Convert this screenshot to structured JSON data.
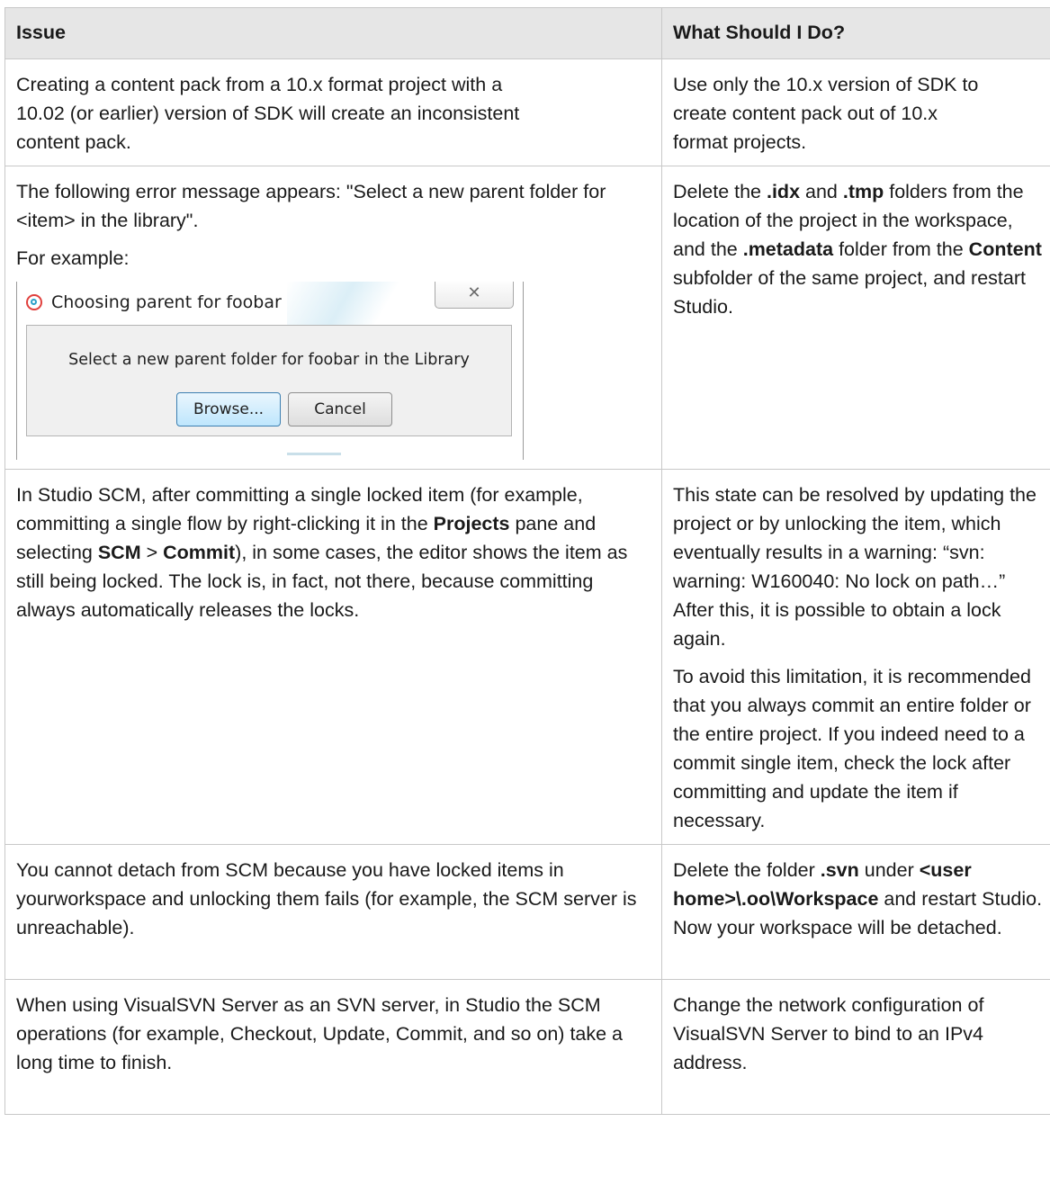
{
  "table": {
    "headers": {
      "issue": "Issue",
      "action": "What Should I Do?"
    },
    "rows": [
      {
        "issue": {
          "line1": "Creating a content pack from a 10.x format project with a",
          "line2": "10.02 (or earlier) version of SDK will create an inconsistent",
          "line3": "content pack."
        },
        "action": {
          "line1": "Use only the 10.x version of SDK to",
          "line2": "create content pack out of 10.x",
          "line3": "format projects."
        }
      },
      {
        "issue": {
          "text": "The following error message appears: \"Select a new parent folder for <item> in the library\".",
          "example_label": "For example:"
        },
        "action": {
          "t1": "Delete the ",
          "b1": ".idx",
          "t2": " and ",
          "b2": ".tmp",
          "t3": " folders from the location of the project in the workspace, and the ",
          "b3": ".metadata",
          "t4": " folder from the ",
          "b4": "Content",
          "t5": " subfolder of the same project, and restart Studio."
        }
      },
      {
        "issue": {
          "t1": "In Studio SCM, after committing a single locked item (for example, committing a single flow by right-clicking it in the ",
          "b1": "Projects",
          "t2": " pane and selecting ",
          "b2": "SCM",
          "t3": " > ",
          "b3": "Commit",
          "t4": "), in some cases, the editor shows the item as still being locked. The lock is, in fact, not there, because committing always automatically releases the locks."
        },
        "action": {
          "p1": "This state can be resolved by updating the project or by unlocking the item, which eventually results in a warning: “svn: warning: W160040: No lock on path…” After this, it is possible to obtain a lock again.",
          "p2": "To avoid this limitation, it is recommended that you always commit an entire folder or the entire project. If you indeed need to a commit single item, check the lock after committing and update the item if necessary."
        }
      },
      {
        "issue": {
          "text": "You cannot detach from SCM because you have locked items in yourworkspace and unlocking them fails (for example, the SCM server is unreachable)."
        },
        "action": {
          "t1": "Delete the folder ",
          "b1": ".svn",
          "t2": " under ",
          "b2": "<user home>\\.oo\\Workspace",
          "t3": " and restart Studio. Now your workspace will be detached."
        }
      },
      {
        "issue": {
          "text": "When using VisualSVN Server as an SVN server, in Studio the SCM operations (for example, Checkout, Update, Commit, and so on) take a long time to finish."
        },
        "action": {
          "text": "Change the network configuration of VisualSVN Server to bind to an IPv4 address."
        }
      }
    ]
  },
  "dialog": {
    "title": "Choosing parent for foobar",
    "close_glyph": "✕",
    "message": "Select a new parent folder for foobar in the Library",
    "browse_label": "Browse...",
    "cancel_label": "Cancel",
    "accent_colors": {
      "icon_ring": "#e0403d",
      "icon_inner": "#2aa0c8",
      "default_button_border": "#3c7fb1"
    }
  }
}
